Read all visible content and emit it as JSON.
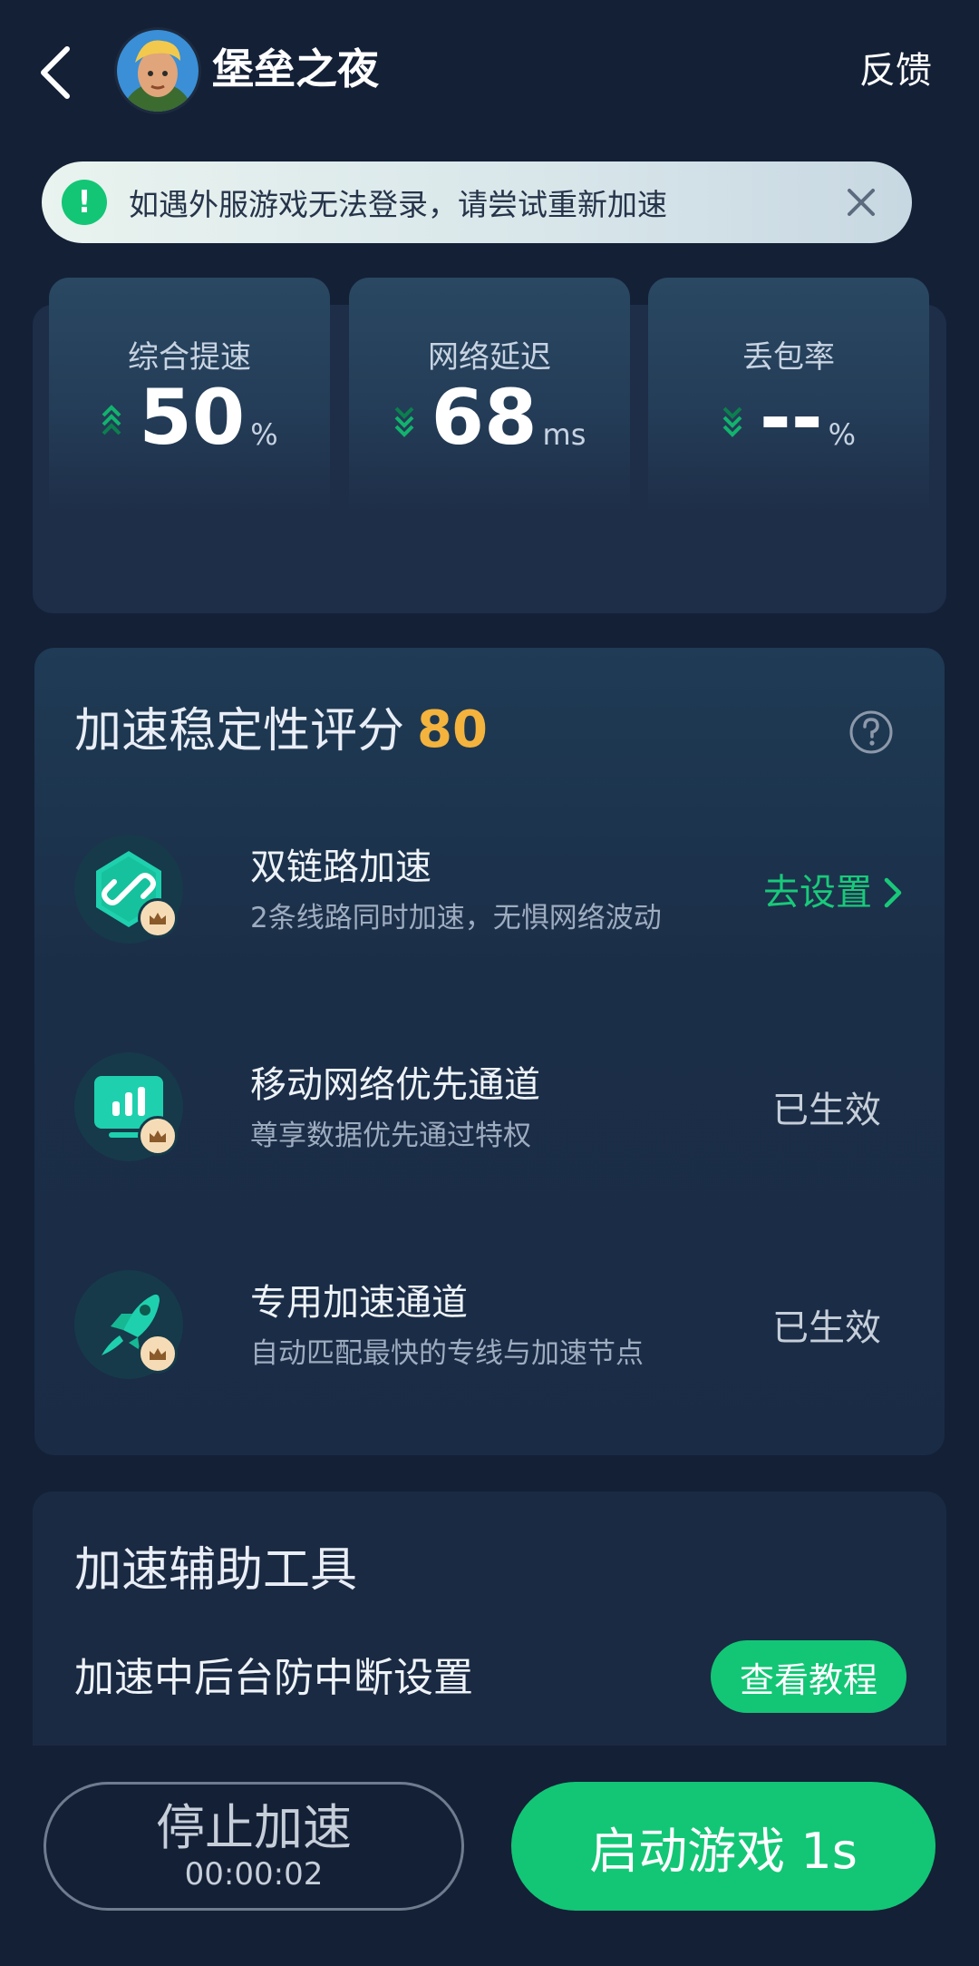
{
  "header": {
    "game_title": "堡垒之夜",
    "feedback_label": "反馈"
  },
  "notice": {
    "message": "如遇外服游戏无法登录，请尝试重新加速"
  },
  "stats": [
    {
      "label": "综合提速",
      "value": "50",
      "unit": "%",
      "trend": "up"
    },
    {
      "label": "网络延迟",
      "value": "68",
      "unit": "ms",
      "trend": "down"
    },
    {
      "label": "丢包率",
      "value": "--",
      "unit": "%",
      "trend": "down"
    }
  ],
  "stability": {
    "title": "加速稳定性评分",
    "score": "80",
    "features": [
      {
        "name": "双链路加速",
        "desc": "2条线路同时加速，无惧网络波动",
        "action": "去设置",
        "icon": "link-icon"
      },
      {
        "name": "移动网络优先通道",
        "desc": "尊享数据优先通过特权",
        "action": "已生效",
        "icon": "chart-icon"
      },
      {
        "name": "专用加速通道",
        "desc": "自动匹配最快的专线与加速节点",
        "action": "已生效",
        "icon": "rocket-icon"
      }
    ]
  },
  "tools": {
    "title": "加速辅助工具",
    "row_label": "加速中后台防中断设置",
    "button_label": "查看教程"
  },
  "bottom": {
    "stop_label": "停止加速",
    "stop_timer": "00:00:02",
    "launch_label": "启动游戏 1s"
  },
  "colors": {
    "accent": "#12c675",
    "score": "#f3b33d",
    "background": "#142036"
  }
}
